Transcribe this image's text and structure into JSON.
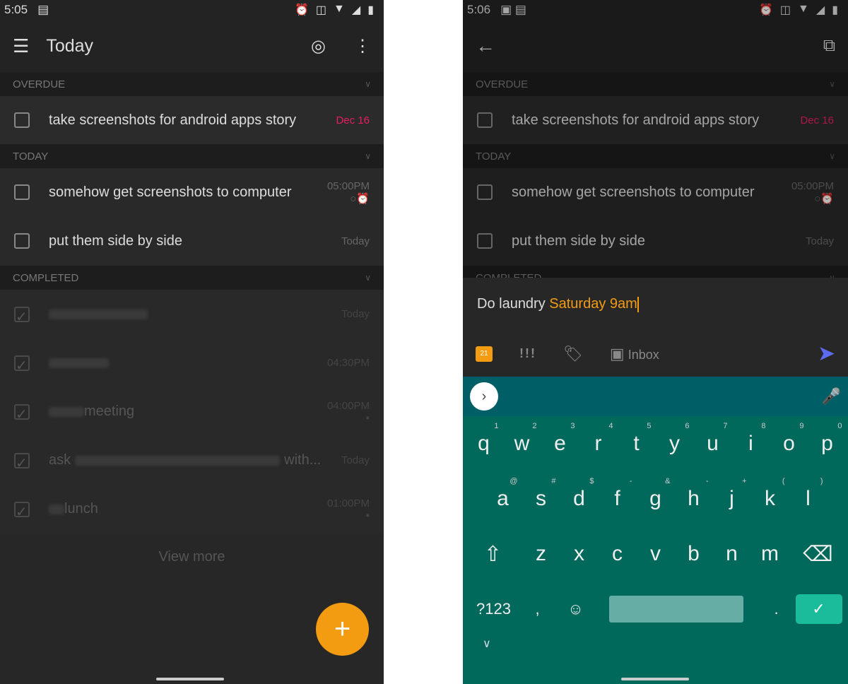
{
  "left": {
    "status": {
      "time": "5:05"
    },
    "title": "Today",
    "sections": {
      "overdue": "OVERDUE",
      "today": "TODAY",
      "completed": "COMPLETED"
    },
    "overdue": [
      {
        "text": "take screenshots for android apps story",
        "meta": "Dec 16"
      }
    ],
    "today": [
      {
        "text": "somehow get screenshots to computer",
        "meta": "05:00PM"
      },
      {
        "text": "put them side by side",
        "meta": "Today"
      }
    ],
    "completed": [
      {
        "text": "",
        "meta": "Today"
      },
      {
        "text": "",
        "meta": "04:30PM"
      },
      {
        "text": "meeting",
        "meta": "04:00PM"
      },
      {
        "text": "ask",
        "text2": "with...",
        "meta": "Today"
      },
      {
        "text": "lunch",
        "meta": "01:00PM"
      }
    ],
    "view_more": "View more",
    "fab": "+"
  },
  "right": {
    "status": {
      "time": "5:06"
    },
    "sections": {
      "overdue": "OVERDUE",
      "today": "TODAY",
      "completed": "COMPLETED"
    },
    "overdue": [
      {
        "text": "take screenshots for android apps story",
        "meta": "Dec 16"
      }
    ],
    "today": [
      {
        "text": "somehow get screenshots to computer",
        "meta": "05:00PM"
      },
      {
        "text": "put them side by side",
        "meta": "Today"
      }
    ],
    "composer": {
      "text": "Do laundry ",
      "highlight": "Saturday 9am",
      "calendar_day": "21",
      "priority": "!!!",
      "project": "Inbox"
    },
    "keyboard": {
      "row1": [
        "q",
        "w",
        "e",
        "r",
        "t",
        "y",
        "u",
        "i",
        "o",
        "p"
      ],
      "row1_sup": [
        "1",
        "2",
        "3",
        "4",
        "5",
        "6",
        "7",
        "8",
        "9",
        "0"
      ],
      "row2": [
        "a",
        "s",
        "d",
        "f",
        "g",
        "h",
        "j",
        "k",
        "l"
      ],
      "row2_sup": [
        "@",
        "#",
        "$",
        "-",
        "&",
        "-",
        "+",
        "(",
        ")"
      ],
      "row3": [
        "z",
        "x",
        "c",
        "v",
        "b",
        "n",
        "m"
      ],
      "sym": "?123",
      "comma": ",",
      "period": "."
    }
  },
  "colors": {
    "accent": "#f39c12",
    "overdue": "#e91e63",
    "send": "#5c6bf2",
    "keyboard": "#00695c"
  }
}
